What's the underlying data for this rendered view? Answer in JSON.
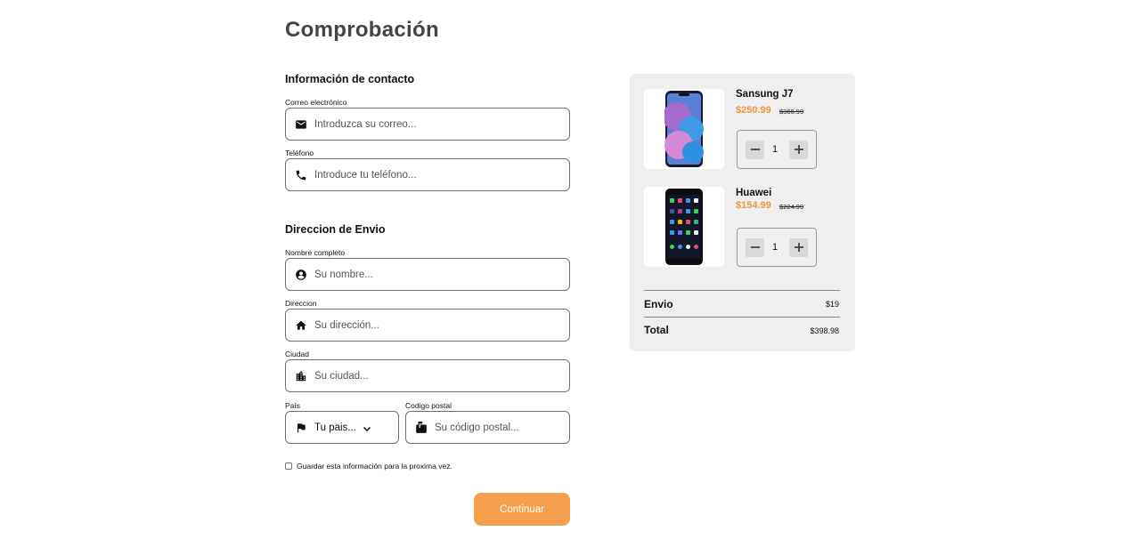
{
  "page": {
    "title": "Comprobación"
  },
  "contact": {
    "title": "Información de contacto",
    "email_label": "Correo electrónico",
    "email_placeholder": "Introduzca su correo...",
    "phone_label": "Teléfono",
    "phone_placeholder": "Introduce tu teléfono..."
  },
  "shipping": {
    "title": "Direccion de Envio",
    "name_label": "Nombre completo",
    "name_placeholder": "Su nombre...",
    "address_label": "Direccion",
    "address_placeholder": "Su dirección...",
    "city_label": "Ciudad",
    "city_placeholder": "Su ciudad...",
    "country_label": "País",
    "country_value": "Tu pais...",
    "postal_label": "Codigo postal",
    "postal_placeholder": "Su código postal...",
    "save_label": "Guardar esta información para la proxima vez.",
    "save_checked": false
  },
  "actions": {
    "continue_label": "Continuar"
  },
  "cart": {
    "items": [
      {
        "name": "Sansung J7",
        "price": "$250.99",
        "old_price": "$366.99",
        "quantity": "1"
      },
      {
        "name": "Huawei",
        "price": "$154.99",
        "old_price": "$224.99",
        "quantity": "1"
      }
    ],
    "shipping_label": "Envio",
    "shipping_value": "$19",
    "total_label": "Total",
    "total_value": "$398.98"
  },
  "colors": {
    "accent": "#f4a04e",
    "price": "#f0953a",
    "cart_bg": "#efefef",
    "border": "#6f6f6f"
  },
  "icons": [
    "mail-icon",
    "phone-icon",
    "account-icon",
    "home-icon",
    "city-icon",
    "flag-icon",
    "chevron-down-icon",
    "mailbox-icon",
    "minus-icon",
    "plus-icon"
  ]
}
